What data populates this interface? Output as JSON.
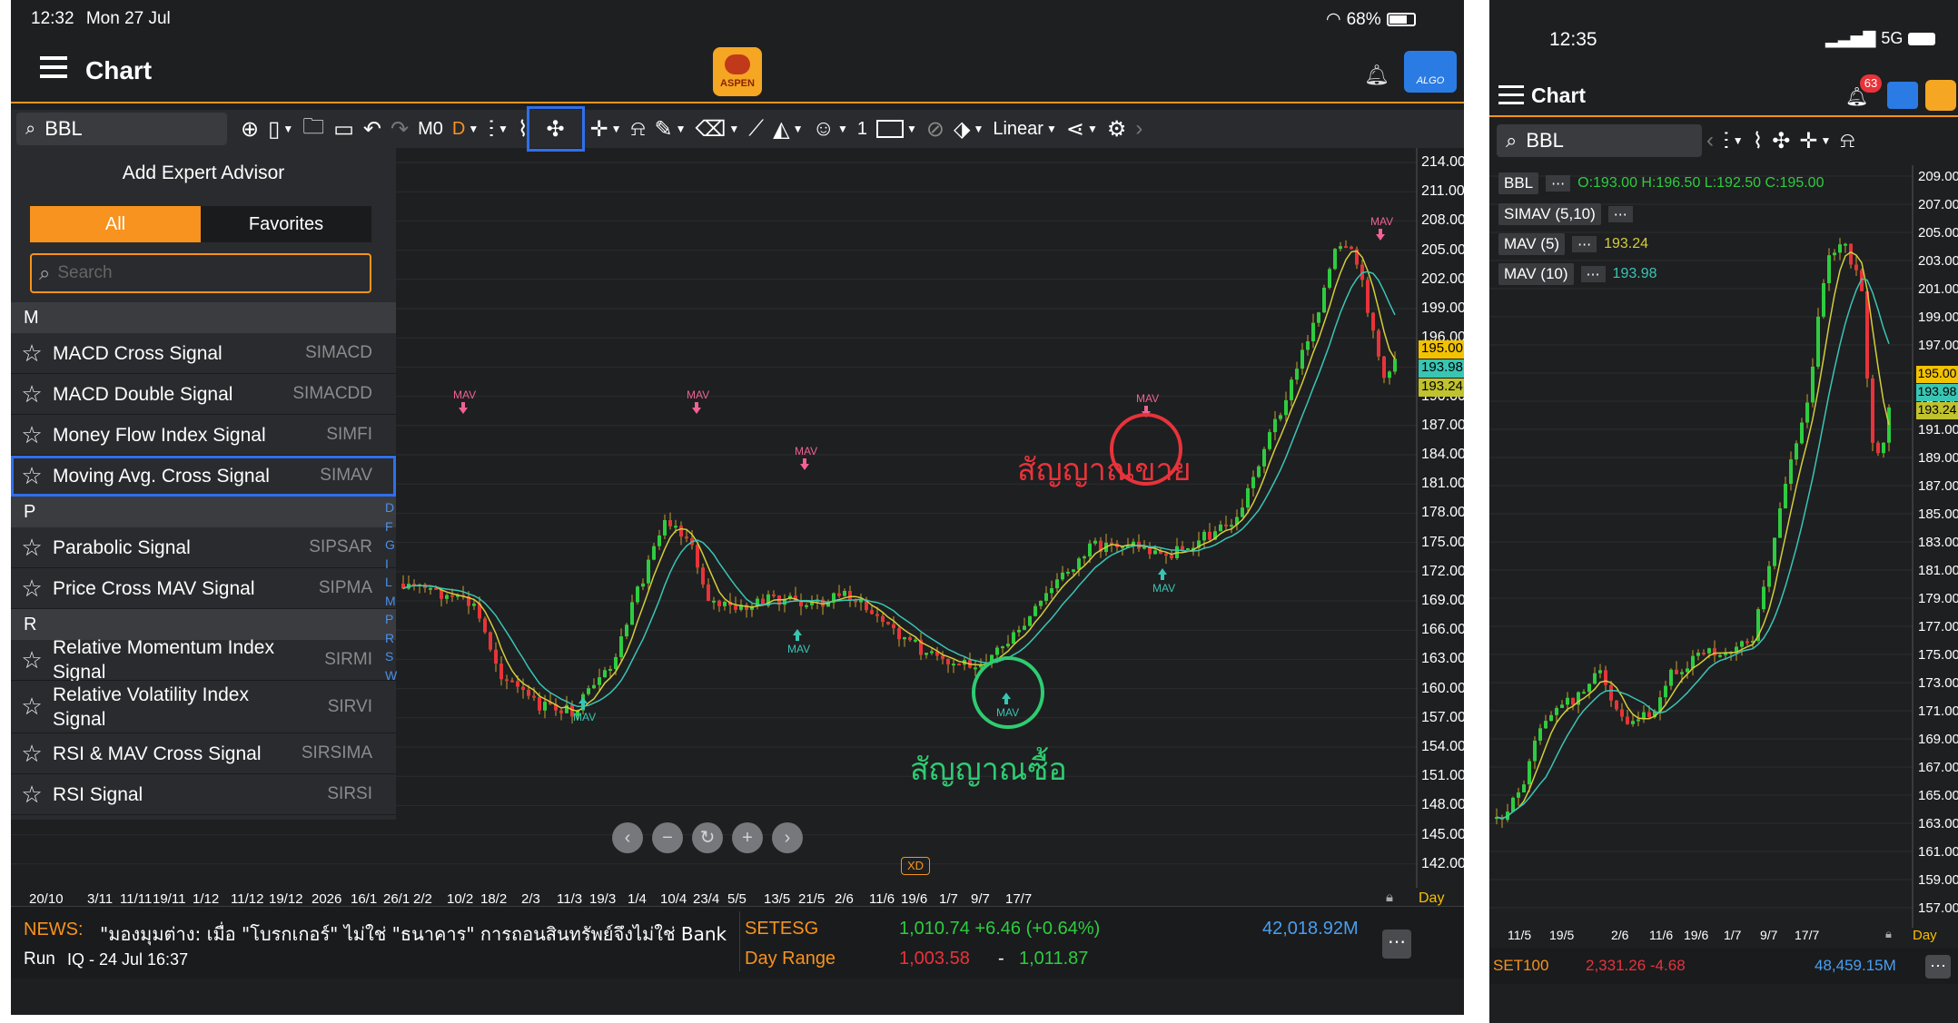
{
  "ipad": {
    "status": {
      "time": "12:32",
      "date": "Mon 27 Jul",
      "battery": "68%"
    },
    "header": {
      "title": "Chart",
      "logo_text": "ASPEN",
      "algo_text": "ALGO"
    },
    "toolbar": {
      "symbol": "BBL",
      "period_m": "M0",
      "period_d": "D",
      "count": "1",
      "scale": "Linear"
    },
    "expert_panel": {
      "title": "Add Expert Advisor",
      "tabs": [
        "All",
        "Favorites"
      ],
      "search_placeholder": "Search",
      "sections": [
        {
          "letter": "M",
          "items": [
            {
              "name": "MACD Cross Signal",
              "code": "SIMACD"
            },
            {
              "name": "MACD Double Signal",
              "code": "SIMACDD"
            },
            {
              "name": "Money Flow Index Signal",
              "code": "SIMFI"
            },
            {
              "name": "Moving Avg. Cross Signal",
              "code": "SIMAV"
            }
          ]
        },
        {
          "letter": "P",
          "items": [
            {
              "name": "Parabolic Signal",
              "code": "SIPSAR"
            },
            {
              "name": "Price Cross MAV Signal",
              "code": "SIPMA"
            }
          ]
        },
        {
          "letter": "R",
          "items": [
            {
              "name": "Relative Momentum Index Signal",
              "code": "SIRMI"
            },
            {
              "name": "Relative Volatility Index Signal",
              "code": "SIRVI"
            },
            {
              "name": "RSI & MAV Cross Signal",
              "code": "SIRSIMA"
            },
            {
              "name": "RSI Signal",
              "code": "SIRSI"
            }
          ]
        }
      ],
      "alpha_index": [
        "D",
        "F",
        "G",
        "I",
        "L",
        "M",
        "P",
        "R",
        "S",
        "W"
      ]
    },
    "chart": {
      "y_ticks": [
        "214.00",
        "211.00",
        "208.00",
        "205.00",
        "202.00",
        "199.00",
        "196.00",
        "193.00",
        "190.00",
        "187.00",
        "184.00",
        "181.00",
        "178.00",
        "175.00",
        "172.00",
        "169.00",
        "166.00",
        "163.00",
        "160.00",
        "157.00",
        "154.00",
        "151.00",
        "148.00",
        "145.00",
        "142.00"
      ],
      "x_ticks": [
        "20/10",
        "3/11",
        "11/11",
        "19/11",
        "1/12",
        "11/12",
        "19/12",
        "2026",
        "16/1",
        "26/1",
        "2/2",
        "10/2",
        "18/2",
        "2/3",
        "11/3",
        "19/3",
        "1/4",
        "10/4",
        "23/4",
        "5/5",
        "13/5",
        "21/5",
        "2/6",
        "11/6",
        "19/6",
        "1/7",
        "9/7",
        "17/7"
      ],
      "period_label": "Day",
      "price_tags": [
        "195.00",
        "193.98",
        "193.24"
      ],
      "signal_label": "MAV",
      "sell_annotation": "สัญญาณขาย",
      "buy_annotation": "สัญญาณซื้อ",
      "xd_label": "XD"
    },
    "news": {
      "label": "NEWS:",
      "headline": "\"มองมุมต่าง: เมื่อ \"โบรกเกอร์\" ไม่ใช่ \"ธนาคาร\" การถอนสินทรัพย์จึงไม่ใช่ Bank",
      "source": "Run",
      "time": "IQ - 24 Jul 16:37"
    },
    "index": {
      "name": "SETESG",
      "value": "1,010.74 +6.46 (+0.64%)",
      "volume": "42,018.92M",
      "range_label": "Day Range",
      "range_low": "1,003.58",
      "range_sep": "-",
      "range_high": "1,011.87"
    }
  },
  "phone": {
    "status": {
      "time": "12:35",
      "network": "5G"
    },
    "header": {
      "title": "Chart",
      "badge": "63"
    },
    "symbol": "BBL",
    "legend": {
      "ohlc": {
        "name": "BBL",
        "values": "O:193.00 H:196.50 L:192.50 C:195.00"
      },
      "simav": "SIMAV (5,10)",
      "mav5": {
        "name": "MAV (5)",
        "value": "193.24"
      },
      "mav10": {
        "name": "MAV (10)",
        "value": "193.98"
      }
    },
    "y_ticks": [
      "209.00",
      "207.00",
      "205.00",
      "203.00",
      "201.00",
      "199.00",
      "197.00",
      "195.00",
      "193.00",
      "191.00",
      "189.00",
      "187.00",
      "185.00",
      "183.00",
      "181.00",
      "179.00",
      "177.00",
      "175.00",
      "173.00",
      "171.00",
      "169.00",
      "167.00",
      "165.00",
      "163.00",
      "161.00",
      "159.00",
      "157.00"
    ],
    "x_ticks": [
      "11/5",
      "19/5",
      "2/6",
      "11/6",
      "19/6",
      "1/7",
      "9/7",
      "17/7"
    ],
    "period_label": "Day",
    "price_tags": [
      "195.00",
      "193.98",
      "193.24"
    ],
    "index": {
      "name": "SET100",
      "value": "2,331.26 -4.68",
      "volume": "48,459.15M"
    }
  },
  "colors": {
    "up": "#2ecc40",
    "down": "#e8333a",
    "mav5": "#d4cd3a",
    "mav10": "#39c5b4",
    "accent": "#f7931e",
    "highlight": "#2f6fed"
  }
}
